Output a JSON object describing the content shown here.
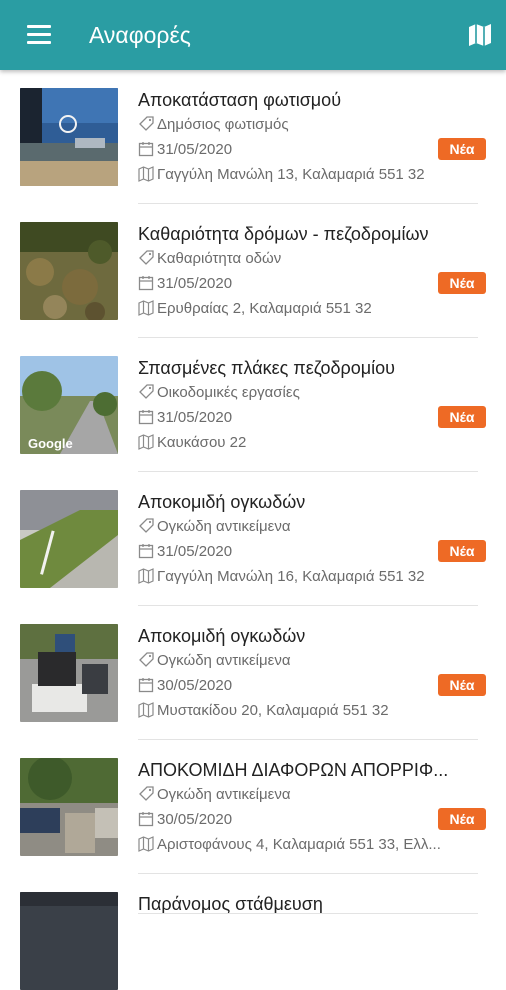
{
  "appbar": {
    "title": "Αναφορές",
    "menu_icon": "hamburger-menu-icon",
    "map_icon": "map-icon",
    "color": "#2a9da3"
  },
  "badge_color": "#ee6a25",
  "icons": {
    "category": "tag-icon",
    "date": "calendar-icon",
    "address": "map-icon"
  },
  "reports": [
    {
      "title": "Αποκατάσταση φωτισμού",
      "category": "Δημόσιος φωτισμός",
      "date": "31/05/2020",
      "address": "Γαγγύλη Μανώλη 13, Καλαμαριά 551 32",
      "status": "Νέα"
    },
    {
      "title": "Καθαριότητα δρόμων - πεζοδρομίων",
      "category": "Καθαριότητα οδών",
      "date": "31/05/2020",
      "address": "Ερυθραίας 2, Καλαμαριά 551 32",
      "status": "Νέα"
    },
    {
      "title": "Σπασμένες πλάκες πεζοδρομίου",
      "category": "Οικοδομικές εργασίες",
      "date": "31/05/2020",
      "address": "Καυκάσου 22",
      "status": "Νέα",
      "photo_watermark": "Google"
    },
    {
      "title": "Αποκομιδή ογκωδών",
      "category": "Ογκώδη αντικείμενα",
      "date": "31/05/2020",
      "address": "Γαγγύλη Μανώλη 16, Καλαμαριά 551 32",
      "status": "Νέα"
    },
    {
      "title": "Αποκομιδή ογκωδών",
      "category": "Ογκώδη αντικείμενα",
      "date": "30/05/2020",
      "address": "Μυστακίδου 20, Καλαμαριά 551 32",
      "status": "Νέα"
    },
    {
      "title": "ΑΠΟΚΟΜΙΔΗ ΔΙΑΦΟΡΩΝ ΑΠΟΡΡΙΦ...",
      "category": "Ογκώδη αντικείμενα",
      "date": "30/05/2020",
      "address": "Αριστοφάνους 4, Καλαμαριά 551 33, Ελλ...",
      "status": "Νέα"
    },
    {
      "title": "Παράνομος στάθμευση"
    }
  ]
}
